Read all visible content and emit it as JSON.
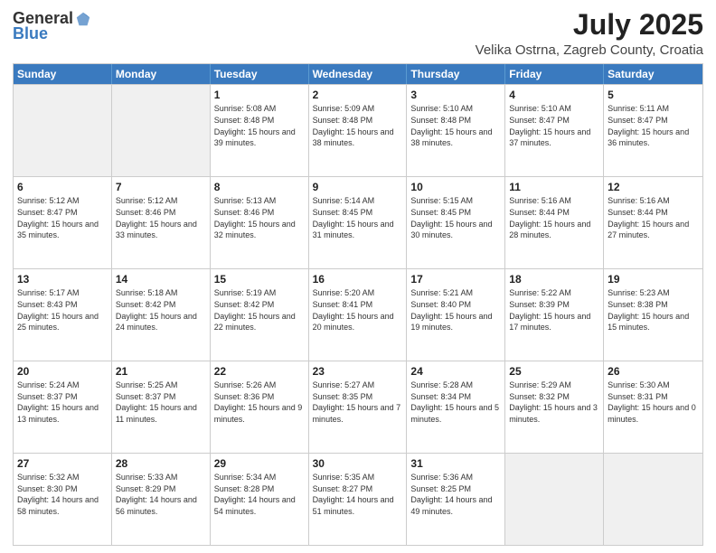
{
  "logo": {
    "general": "General",
    "blue": "Blue"
  },
  "title": "July 2025",
  "subtitle": "Velika Ostrna, Zagreb County, Croatia",
  "header_days": [
    "Sunday",
    "Monday",
    "Tuesday",
    "Wednesday",
    "Thursday",
    "Friday",
    "Saturday"
  ],
  "weeks": [
    [
      {
        "day": "",
        "sunrise": "",
        "sunset": "",
        "daylight": "",
        "empty": true
      },
      {
        "day": "",
        "sunrise": "",
        "sunset": "",
        "daylight": "",
        "empty": true
      },
      {
        "day": "1",
        "sunrise": "Sunrise: 5:08 AM",
        "sunset": "Sunset: 8:48 PM",
        "daylight": "Daylight: 15 hours and 39 minutes."
      },
      {
        "day": "2",
        "sunrise": "Sunrise: 5:09 AM",
        "sunset": "Sunset: 8:48 PM",
        "daylight": "Daylight: 15 hours and 38 minutes."
      },
      {
        "day": "3",
        "sunrise": "Sunrise: 5:10 AM",
        "sunset": "Sunset: 8:48 PM",
        "daylight": "Daylight: 15 hours and 38 minutes."
      },
      {
        "day": "4",
        "sunrise": "Sunrise: 5:10 AM",
        "sunset": "Sunset: 8:47 PM",
        "daylight": "Daylight: 15 hours and 37 minutes."
      },
      {
        "day": "5",
        "sunrise": "Sunrise: 5:11 AM",
        "sunset": "Sunset: 8:47 PM",
        "daylight": "Daylight: 15 hours and 36 minutes."
      }
    ],
    [
      {
        "day": "6",
        "sunrise": "Sunrise: 5:12 AM",
        "sunset": "Sunset: 8:47 PM",
        "daylight": "Daylight: 15 hours and 35 minutes."
      },
      {
        "day": "7",
        "sunrise": "Sunrise: 5:12 AM",
        "sunset": "Sunset: 8:46 PM",
        "daylight": "Daylight: 15 hours and 33 minutes."
      },
      {
        "day": "8",
        "sunrise": "Sunrise: 5:13 AM",
        "sunset": "Sunset: 8:46 PM",
        "daylight": "Daylight: 15 hours and 32 minutes."
      },
      {
        "day": "9",
        "sunrise": "Sunrise: 5:14 AM",
        "sunset": "Sunset: 8:45 PM",
        "daylight": "Daylight: 15 hours and 31 minutes."
      },
      {
        "day": "10",
        "sunrise": "Sunrise: 5:15 AM",
        "sunset": "Sunset: 8:45 PM",
        "daylight": "Daylight: 15 hours and 30 minutes."
      },
      {
        "day": "11",
        "sunrise": "Sunrise: 5:16 AM",
        "sunset": "Sunset: 8:44 PM",
        "daylight": "Daylight: 15 hours and 28 minutes."
      },
      {
        "day": "12",
        "sunrise": "Sunrise: 5:16 AM",
        "sunset": "Sunset: 8:44 PM",
        "daylight": "Daylight: 15 hours and 27 minutes."
      }
    ],
    [
      {
        "day": "13",
        "sunrise": "Sunrise: 5:17 AM",
        "sunset": "Sunset: 8:43 PM",
        "daylight": "Daylight: 15 hours and 25 minutes."
      },
      {
        "day": "14",
        "sunrise": "Sunrise: 5:18 AM",
        "sunset": "Sunset: 8:42 PM",
        "daylight": "Daylight: 15 hours and 24 minutes."
      },
      {
        "day": "15",
        "sunrise": "Sunrise: 5:19 AM",
        "sunset": "Sunset: 8:42 PM",
        "daylight": "Daylight: 15 hours and 22 minutes."
      },
      {
        "day": "16",
        "sunrise": "Sunrise: 5:20 AM",
        "sunset": "Sunset: 8:41 PM",
        "daylight": "Daylight: 15 hours and 20 minutes."
      },
      {
        "day": "17",
        "sunrise": "Sunrise: 5:21 AM",
        "sunset": "Sunset: 8:40 PM",
        "daylight": "Daylight: 15 hours and 19 minutes."
      },
      {
        "day": "18",
        "sunrise": "Sunrise: 5:22 AM",
        "sunset": "Sunset: 8:39 PM",
        "daylight": "Daylight: 15 hours and 17 minutes."
      },
      {
        "day": "19",
        "sunrise": "Sunrise: 5:23 AM",
        "sunset": "Sunset: 8:38 PM",
        "daylight": "Daylight: 15 hours and 15 minutes."
      }
    ],
    [
      {
        "day": "20",
        "sunrise": "Sunrise: 5:24 AM",
        "sunset": "Sunset: 8:37 PM",
        "daylight": "Daylight: 15 hours and 13 minutes."
      },
      {
        "day": "21",
        "sunrise": "Sunrise: 5:25 AM",
        "sunset": "Sunset: 8:37 PM",
        "daylight": "Daylight: 15 hours and 11 minutes."
      },
      {
        "day": "22",
        "sunrise": "Sunrise: 5:26 AM",
        "sunset": "Sunset: 8:36 PM",
        "daylight": "Daylight: 15 hours and 9 minutes."
      },
      {
        "day": "23",
        "sunrise": "Sunrise: 5:27 AM",
        "sunset": "Sunset: 8:35 PM",
        "daylight": "Daylight: 15 hours and 7 minutes."
      },
      {
        "day": "24",
        "sunrise": "Sunrise: 5:28 AM",
        "sunset": "Sunset: 8:34 PM",
        "daylight": "Daylight: 15 hours and 5 minutes."
      },
      {
        "day": "25",
        "sunrise": "Sunrise: 5:29 AM",
        "sunset": "Sunset: 8:32 PM",
        "daylight": "Daylight: 15 hours and 3 minutes."
      },
      {
        "day": "26",
        "sunrise": "Sunrise: 5:30 AM",
        "sunset": "Sunset: 8:31 PM",
        "daylight": "Daylight: 15 hours and 0 minutes."
      }
    ],
    [
      {
        "day": "27",
        "sunrise": "Sunrise: 5:32 AM",
        "sunset": "Sunset: 8:30 PM",
        "daylight": "Daylight: 14 hours and 58 minutes."
      },
      {
        "day": "28",
        "sunrise": "Sunrise: 5:33 AM",
        "sunset": "Sunset: 8:29 PM",
        "daylight": "Daylight: 14 hours and 56 minutes."
      },
      {
        "day": "29",
        "sunrise": "Sunrise: 5:34 AM",
        "sunset": "Sunset: 8:28 PM",
        "daylight": "Daylight: 14 hours and 54 minutes."
      },
      {
        "day": "30",
        "sunrise": "Sunrise: 5:35 AM",
        "sunset": "Sunset: 8:27 PM",
        "daylight": "Daylight: 14 hours and 51 minutes."
      },
      {
        "day": "31",
        "sunrise": "Sunrise: 5:36 AM",
        "sunset": "Sunset: 8:25 PM",
        "daylight": "Daylight: 14 hours and 49 minutes."
      },
      {
        "day": "",
        "sunrise": "",
        "sunset": "",
        "daylight": "",
        "empty": true
      },
      {
        "day": "",
        "sunrise": "",
        "sunset": "",
        "daylight": "",
        "empty": true
      }
    ]
  ],
  "accent_color": "#3a7abf"
}
